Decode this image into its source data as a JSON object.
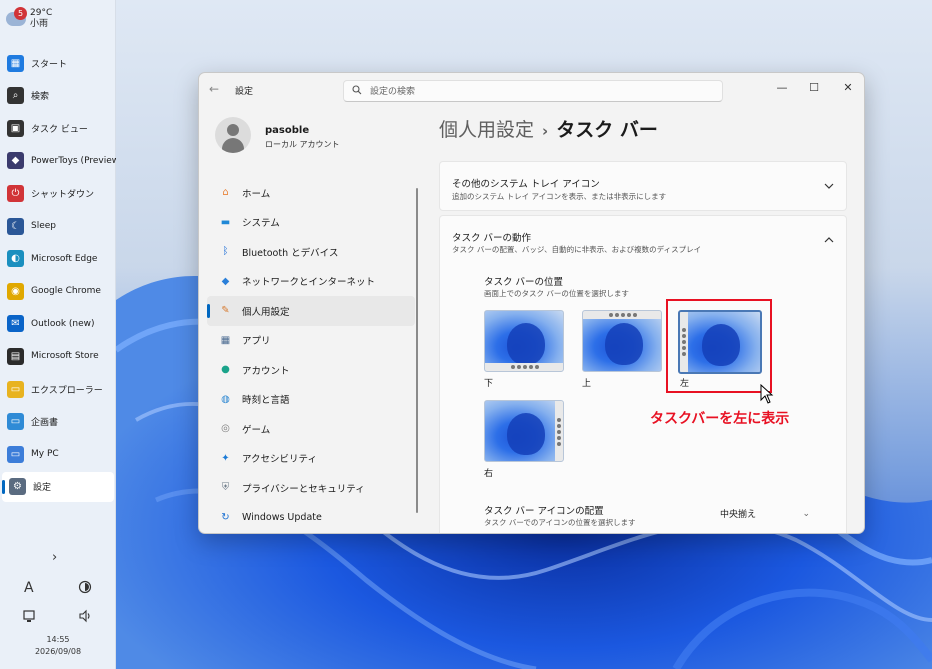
{
  "taskbar": {
    "weather": {
      "badge": "5",
      "temp": "29°C",
      "cond": "小雨"
    },
    "items": [
      {
        "label": "スタート",
        "icon": "windows-logo-icon",
        "color": "#1f7be0"
      },
      {
        "label": "検索",
        "icon": "search-icon",
        "color": "#333333"
      },
      {
        "label": "タスク ビュー",
        "icon": "task-view-icon",
        "color": "#333333"
      },
      {
        "label": "PowerToys (Preview)",
        "icon": "powertoys-icon",
        "color": "#3b3b6d"
      },
      {
        "label": "シャットダウン",
        "icon": "shutdown-icon",
        "color": "#d13438"
      },
      {
        "label": "Sleep",
        "icon": "sleep-icon",
        "color": "#2b5797"
      },
      {
        "label": "Microsoft Edge",
        "icon": "edge-icon",
        "color": "#1a8fbf"
      },
      {
        "label": "Google Chrome",
        "icon": "chrome-icon",
        "color": "#e0a800"
      },
      {
        "label": "Outlook (new)",
        "icon": "outlook-icon",
        "color": "#0a64c8"
      },
      {
        "label": "Microsoft Store",
        "icon": "store-icon",
        "color": "#2b2b2b"
      },
      {
        "label": "エクスプローラー",
        "icon": "folder-icon",
        "color": "#e8b320"
      },
      {
        "label": "企画書",
        "icon": "folder-icon",
        "color": "#2f8bd6"
      },
      {
        "label": "My PC",
        "icon": "pc-icon",
        "color": "#3c7dd9"
      },
      {
        "label": "設定",
        "icon": "gear-icon",
        "color": "#5a6b80"
      }
    ],
    "expand": "›",
    "font_glyph": "A",
    "clock": {
      "time": "14:55",
      "date": "2026/09/08"
    }
  },
  "window": {
    "title": "設定",
    "back": "←",
    "search_placeholder": "設定の検索",
    "controls": {
      "min": "—",
      "max": "☐",
      "close": "✕"
    },
    "user": {
      "name": "pasoble",
      "sub": "ローカル アカウント"
    },
    "nav": [
      {
        "label": "ホーム",
        "icon": "home-icon",
        "color": "#e8833a"
      },
      {
        "label": "システム",
        "icon": "system-icon",
        "color": "#1f88d6"
      },
      {
        "label": "Bluetooth とデバイス",
        "icon": "bluetooth-icon",
        "color": "#1f6fd6"
      },
      {
        "label": "ネットワークとインターネット",
        "icon": "wifi-icon",
        "color": "#2a7fd9"
      },
      {
        "label": "個人用設定",
        "icon": "pen-icon",
        "color": "#d67a30"
      },
      {
        "label": "アプリ",
        "icon": "apps-icon",
        "color": "#4a6a90"
      },
      {
        "label": "アカウント",
        "icon": "account-icon",
        "color": "#1aa38a"
      },
      {
        "label": "時刻と言語",
        "icon": "globe-clock-icon",
        "color": "#2a86d1"
      },
      {
        "label": "ゲーム",
        "icon": "gamepad-icon",
        "color": "#7a7a7a"
      },
      {
        "label": "アクセシビリティ",
        "icon": "accessibility-icon",
        "color": "#1a7ad6"
      },
      {
        "label": "プライバシーとセキュリティ",
        "icon": "shield-icon",
        "color": "#6f7c8a"
      },
      {
        "label": "Windows Update",
        "icon": "update-icon",
        "color": "#1a6fd1"
      }
    ],
    "breadcrumb": {
      "parent": "個人用設定",
      "sep": "›",
      "current": "タスク バー"
    },
    "cards": {
      "tray": {
        "title": "その他のシステム トレイ アイコン",
        "sub": "追加のシステム トレイ アイコンを表示、または非表示にします"
      },
      "behavior": {
        "title": "タスク バーの動作",
        "sub": "タスク バーの配置、バッジ、自動的に非表示、および複数のディスプレイ"
      },
      "position": {
        "title": "タスク バーの位置",
        "sub": "画面上でのタスク バーの位置を選択します",
        "options": [
          {
            "label": "下"
          },
          {
            "label": "上"
          },
          {
            "label": "左"
          },
          {
            "label": "右"
          }
        ],
        "selected": "左"
      },
      "alignment": {
        "title": "タスク バー アイコンの配置",
        "sub": "タスク バーでのアイコンの位置を選択します",
        "value": "中央揃え",
        "arrow": "⌄"
      }
    }
  },
  "annotation": "タスクバーを左に表示",
  "colors": {
    "accent": "#0067c0",
    "annotation": "#e81123"
  }
}
